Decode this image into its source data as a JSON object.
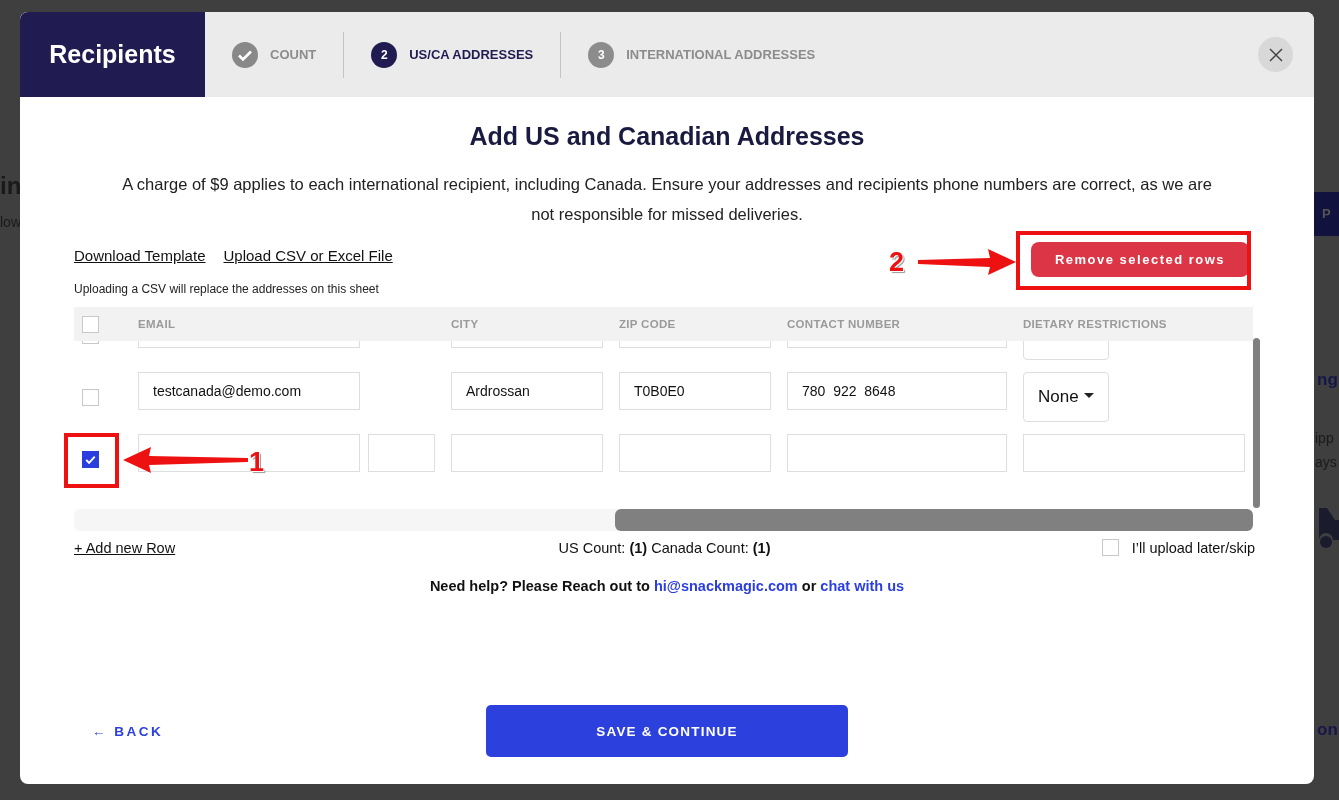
{
  "backdrop": {
    "left_fragments": [
      "in",
      "low"
    ],
    "right_fragments": [
      {
        "text": "P",
        "kind": "button"
      },
      {
        "text": "ng",
        "kind": "link"
      },
      {
        "text": "ipp",
        "kind": "text"
      },
      {
        "text": "ays",
        "kind": "text"
      },
      {
        "text": "on",
        "kind": "link"
      }
    ]
  },
  "modal": {
    "title": "Recipients",
    "steps": [
      {
        "label": "COUNT",
        "done": true,
        "selected": false
      },
      {
        "number": "2",
        "label": "US/CA ADDRESSES",
        "done": false,
        "selected": true
      },
      {
        "number": "3",
        "label": "INTERNATIONAL ADDRESSES",
        "done": false,
        "selected": false
      }
    ],
    "heading": "Add US and Canadian Addresses",
    "notice": "A charge of $9 applies to each international recipient, including Canada. Ensure your addresses and recipients phone numbers are correct, as we are not responsible for missed deliveries.",
    "links": [
      "Download Template",
      "Upload CSV or Excel File"
    ],
    "upload_note": "Uploading a CSV will replace the addresses on this sheet",
    "remove_button": "Remove selected rows",
    "table": {
      "select_all_checked": false,
      "columns": [
        "EMAIL",
        "CITY",
        "ZIP CODE",
        "CONTACT NUMBER",
        "DIETARY RESTRICTIONS"
      ],
      "rows": [
        {
          "checked": false,
          "dietary": {
            "kind": "select"
          }
        },
        {
          "checked": false,
          "email": "testcanada@demo.com",
          "city": "Ardrossan",
          "zip": "T0B0E0",
          "contact": "780  922  8648",
          "dietary": {
            "kind": "select",
            "value": "None"
          }
        },
        {
          "checked": true,
          "dietary": {
            "kind": "input"
          }
        }
      ]
    },
    "add_row": "+ Add new Row",
    "counts": "US Count: **(1)** Canada Count: **(1)**",
    "skip": {
      "label": "I’ll upload later/skip",
      "checked": false
    },
    "help": {
      "text": "Need help? Please Reach out to",
      "email": "hi@snackmagic.com",
      "joiner": "or",
      "chat": "chat with us"
    },
    "back": "← BACK",
    "save": "SAVE & CONTINUE"
  },
  "annotations": [
    {
      "number": "1"
    },
    {
      "number": "2"
    }
  ]
}
